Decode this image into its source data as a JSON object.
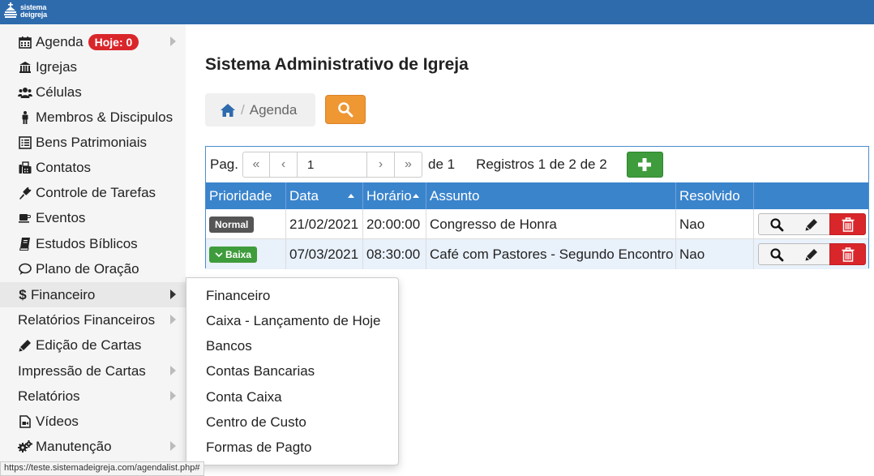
{
  "topbar": {
    "logo_line1": "sistema",
    "logo_line2": "deigreja",
    "color": "#2e6bad"
  },
  "sidebar": {
    "items": [
      {
        "label": "Agenda",
        "icon": "calendar-icon",
        "badge": "Hoje: 0",
        "arrow": true
      },
      {
        "label": "Igrejas",
        "icon": "bank-icon",
        "arrow": false
      },
      {
        "label": "Células",
        "icon": "users-icon",
        "arrow": false
      },
      {
        "label": "Membros & Discipulos",
        "icon": "male-icon",
        "arrow": false
      },
      {
        "label": "Bens Patrimoniais",
        "icon": "list-icon",
        "arrow": false
      },
      {
        "label": "Contatos",
        "icon": "fax-icon",
        "arrow": false
      },
      {
        "label": "Controle de Tarefas",
        "icon": "plug-icon",
        "arrow": false
      },
      {
        "label": "Eventos",
        "icon": "coffee-icon",
        "arrow": false
      },
      {
        "label": "Estudos Bíblicos",
        "icon": "book-icon",
        "arrow": false
      },
      {
        "label": "Plano de Oração",
        "icon": "chat-icon",
        "arrow": false
      },
      {
        "label": "Financeiro",
        "icon": "dollar-icon",
        "arrow": true,
        "active": true
      },
      {
        "label": "Relatórios Financeiros",
        "icon": "",
        "arrow": true
      },
      {
        "label": "Edição de Cartas",
        "icon": "pencil-icon",
        "arrow": false
      },
      {
        "label": "Impressão de Cartas",
        "icon": "",
        "arrow": true
      },
      {
        "label": "Relatórios",
        "icon": "",
        "arrow": true
      },
      {
        "label": "Vídeos",
        "icon": "video-icon",
        "arrow": false
      },
      {
        "label": "Manutenção",
        "icon": "gears-icon",
        "arrow": true
      }
    ]
  },
  "submenu": {
    "items": [
      "Financeiro",
      "Caixa - Lançamento de Hoje",
      "Bancos",
      "Contas Bancarias",
      "Conta Caixa",
      "Centro de Custo",
      "Formas de Pagto"
    ]
  },
  "main": {
    "title": "Sistema Administrativo de Igreja",
    "breadcrumb": {
      "current": "Agenda",
      "separator": "/"
    },
    "search_color": "#ef9733"
  },
  "pager": {
    "label": "Pag.",
    "page": "1",
    "of_label": "de 1",
    "records": "Registros 1 de 2 de 2"
  },
  "table": {
    "headers": {
      "prioridade": "Prioridade",
      "data": "Data",
      "horario": "Horário",
      "assunto": "Assunto",
      "resolvido": "Resolvido"
    },
    "rows": [
      {
        "prioridade": "Normal",
        "data": "21/02/2021",
        "horario": "20:00:00",
        "assunto": "Congresso de Honra",
        "resolvido": "Nao"
      },
      {
        "prioridade": "Baixa",
        "data": "07/03/2021",
        "horario": "08:30:00",
        "assunto": "Café com Pastores - Segundo Encontro",
        "resolvido": "Nao"
      }
    ]
  },
  "statusbar": {
    "url": "https://teste.sistemadeigreja.com/agendalist.php#"
  }
}
